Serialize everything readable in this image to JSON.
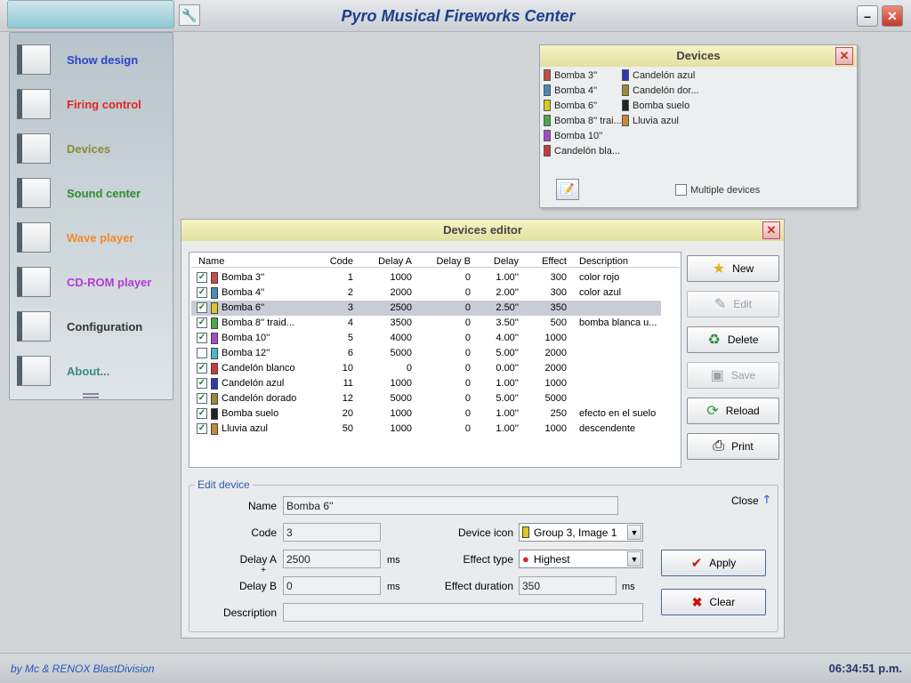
{
  "app": {
    "title": "Pyro Musical Fireworks Center"
  },
  "sidebar": {
    "items": [
      {
        "label": "Show design",
        "color": "#2f43c8"
      },
      {
        "label": "Firing control",
        "color": "#e02424"
      },
      {
        "label": "Devices",
        "color": "#8a8a3a"
      },
      {
        "label": "Sound center",
        "color": "#2a8f2a"
      },
      {
        "label": "Wave player",
        "color": "#f08a2a"
      },
      {
        "label": "CD-ROM player",
        "color": "#b23ad6"
      },
      {
        "label": "Configuration",
        "color": "#333333"
      },
      {
        "label": "About...",
        "color": "#3a8a8a"
      }
    ]
  },
  "devices_panel": {
    "title": "Devices",
    "col1": [
      "Bomba 3''",
      "Bomba 4''",
      "Bomba 6''",
      "Bomba 8'' trai...",
      "Bomba 10''",
      "Candelón bla..."
    ],
    "col2": [
      "Candelón azul",
      "Candelón dor...",
      "Bomba suelo",
      "Lluvia azul"
    ],
    "multiple_label": "Multiple devices"
  },
  "editor": {
    "title": "Devices editor",
    "columns": [
      "Name",
      "Code",
      "Delay A",
      "Delay B",
      "Delay",
      "Effect",
      "Description"
    ],
    "rows": [
      {
        "checked": true,
        "name": "Bomba 3''",
        "code": "1",
        "delay_a": "1000",
        "delay_b": "0",
        "delay": "1.00''",
        "effect": "300",
        "description": "color rojo",
        "color": "#c84a4a"
      },
      {
        "checked": true,
        "name": "Bomba 4''",
        "code": "2",
        "delay_a": "2000",
        "delay_b": "0",
        "delay": "2.00''",
        "effect": "300",
        "description": "color azul",
        "color": "#4a8ab8"
      },
      {
        "checked": true,
        "name": "Bomba 6''",
        "code": "3",
        "delay_a": "2500",
        "delay_b": "0",
        "delay": "2.50''",
        "effect": "350",
        "description": "",
        "color": "#d8c820",
        "selected": true
      },
      {
        "checked": true,
        "name": "Bomba 8'' traid...",
        "code": "4",
        "delay_a": "3500",
        "delay_b": "0",
        "delay": "3.50''",
        "effect": "500",
        "description": "bomba blanca u...",
        "color": "#4aa84a"
      },
      {
        "checked": true,
        "name": "Bomba 10''",
        "code": "5",
        "delay_a": "4000",
        "delay_b": "0",
        "delay": "4.00''",
        "effect": "1000",
        "description": "",
        "color": "#a84ac8"
      },
      {
        "checked": false,
        "name": "Bomba 12''",
        "code": "6",
        "delay_a": "5000",
        "delay_b": "0",
        "delay": "5.00''",
        "effect": "2000",
        "description": "",
        "color": "#4ab8c8"
      },
      {
        "checked": true,
        "name": "Candelón blanco",
        "code": "10",
        "delay_a": "0",
        "delay_b": "0",
        "delay": "0.00''",
        "effect": "2000",
        "description": "",
        "color": "#c83a3a"
      },
      {
        "checked": true,
        "name": "Candelón azul",
        "code": "11",
        "delay_a": "1000",
        "delay_b": "0",
        "delay": "1.00''",
        "effect": "1000",
        "description": "",
        "color": "#2a3ab8"
      },
      {
        "checked": true,
        "name": "Candelón dorado",
        "code": "12",
        "delay_a": "5000",
        "delay_b": "0",
        "delay": "5.00''",
        "effect": "5000",
        "description": "",
        "color": "#9a8a3a"
      },
      {
        "checked": true,
        "name": "Bomba suelo",
        "code": "20",
        "delay_a": "1000",
        "delay_b": "0",
        "delay": "1.00''",
        "effect": "250",
        "description": "efecto en el suelo",
        "color": "#222222"
      },
      {
        "checked": true,
        "name": "Lluvia azul",
        "code": "50",
        "delay_a": "1000",
        "delay_b": "0",
        "delay": "1.00''",
        "effect": "1000",
        "description": "descendente",
        "color": "#c88a3a"
      }
    ],
    "buttons": [
      {
        "label": "New",
        "icon": "★",
        "enabled": true
      },
      {
        "label": "Edit",
        "icon": "✎",
        "enabled": false
      },
      {
        "label": "Delete",
        "icon": "♻",
        "enabled": true
      },
      {
        "label": "Save",
        "icon": "▣",
        "enabled": false
      },
      {
        "label": "Reload",
        "icon": "⟳",
        "enabled": true
      },
      {
        "label": "Print",
        "icon": "⎙",
        "enabled": true
      }
    ],
    "form": {
      "legend": "Edit device",
      "close_label": "Close",
      "name_label": "Name",
      "name_value": "Bomba 6''",
      "code_label": "Code",
      "code_value": "3",
      "delay_a_label": "Delay A",
      "delay_a_value": "2500",
      "plus": "+",
      "delay_b_label": "Delay B",
      "delay_b_value": "0",
      "ms": "ms",
      "description_label": "Description",
      "description_value": "",
      "device_icon_label": "Device icon",
      "device_icon_value": "Group 3, Image 1",
      "effect_type_label": "Effect type",
      "effect_type_value": "Highest",
      "effect_duration_label": "Effect duration",
      "effect_duration_value": "350",
      "apply_label": "Apply",
      "clear_label": "Clear"
    }
  },
  "status": {
    "credit": "by Mc & RENOX BlastDivision",
    "time": "06:34:51 p.m."
  }
}
